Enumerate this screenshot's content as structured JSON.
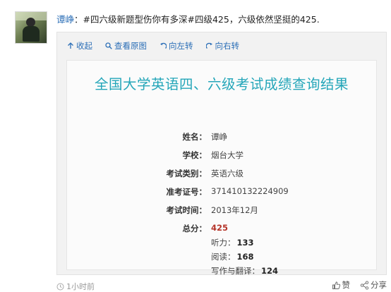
{
  "post": {
    "author": "谭峥",
    "colon": "：",
    "text": "#四六级新题型伤你有多深#四级425，六级依然坚挺的425."
  },
  "toolbar": {
    "collapse": "收起",
    "view_original": "查看原图",
    "rotate_left": "向左转",
    "rotate_right": "向右转"
  },
  "result": {
    "title": "全国大学英语四、六级考试成绩查询结果",
    "fields": [
      {
        "label": "姓名：",
        "value": "谭峥"
      },
      {
        "label": "学校：",
        "value": "烟台大学"
      },
      {
        "label": "考试类别：",
        "value": "英语六级"
      },
      {
        "label": "准考证号：",
        "value": "371410132224909"
      },
      {
        "label": "考试时间：",
        "value": "2013年12月"
      }
    ],
    "total_label": "总分：",
    "total_value": "425",
    "subscores": [
      {
        "label": "听力：",
        "value": "133"
      },
      {
        "label": "阅读：",
        "value": "168"
      },
      {
        "label": "写作与翻译：",
        "value": "124"
      }
    ]
  },
  "footer": {
    "time": "1小时前",
    "like": "赞",
    "share": "分享"
  },
  "colors": {
    "link": "#2c6fb7",
    "title": "#24a6b9",
    "total": "#b5342a"
  }
}
